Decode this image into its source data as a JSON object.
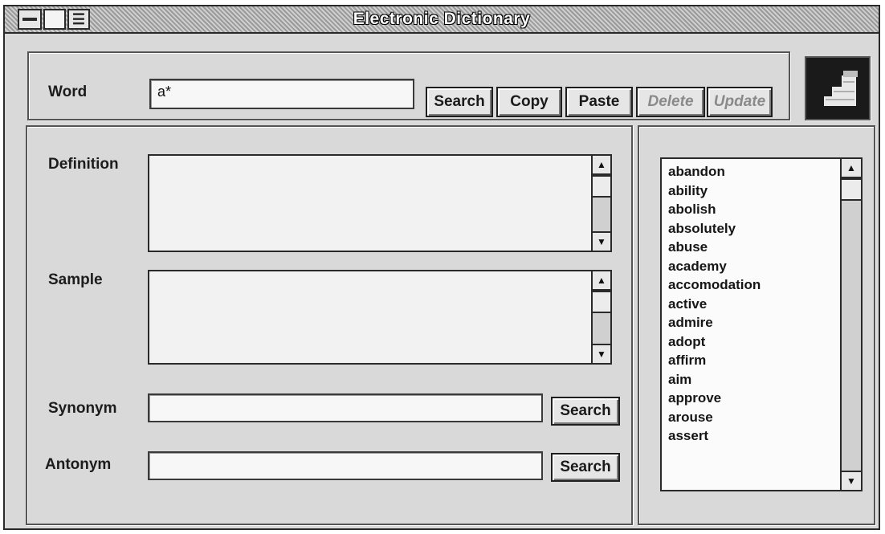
{
  "window": {
    "title": "Electronic Dictionary"
  },
  "word": {
    "label": "Word",
    "value": "a*"
  },
  "toolbar": {
    "search_label": "Search",
    "copy_label": "Copy",
    "paste_label": "Paste",
    "delete_label": "Delete",
    "update_label": "Update"
  },
  "definition": {
    "label": "Definition",
    "value": ""
  },
  "sample": {
    "label": "Sample",
    "value": ""
  },
  "synonym": {
    "label": "Synonym",
    "value": "",
    "search_label": "Search"
  },
  "antonym": {
    "label": "Antonym",
    "value": "",
    "search_label": "Search"
  },
  "wordlist": {
    "items": [
      "abandon",
      "ability",
      "abolish",
      "absolutely",
      "abuse",
      "academy",
      "accomodation",
      "active",
      "admire",
      "adopt",
      "affirm",
      "aim",
      "approve",
      "arouse",
      "assert"
    ]
  },
  "icons": {
    "scroll_up": "▲",
    "scroll_down": "▼"
  }
}
